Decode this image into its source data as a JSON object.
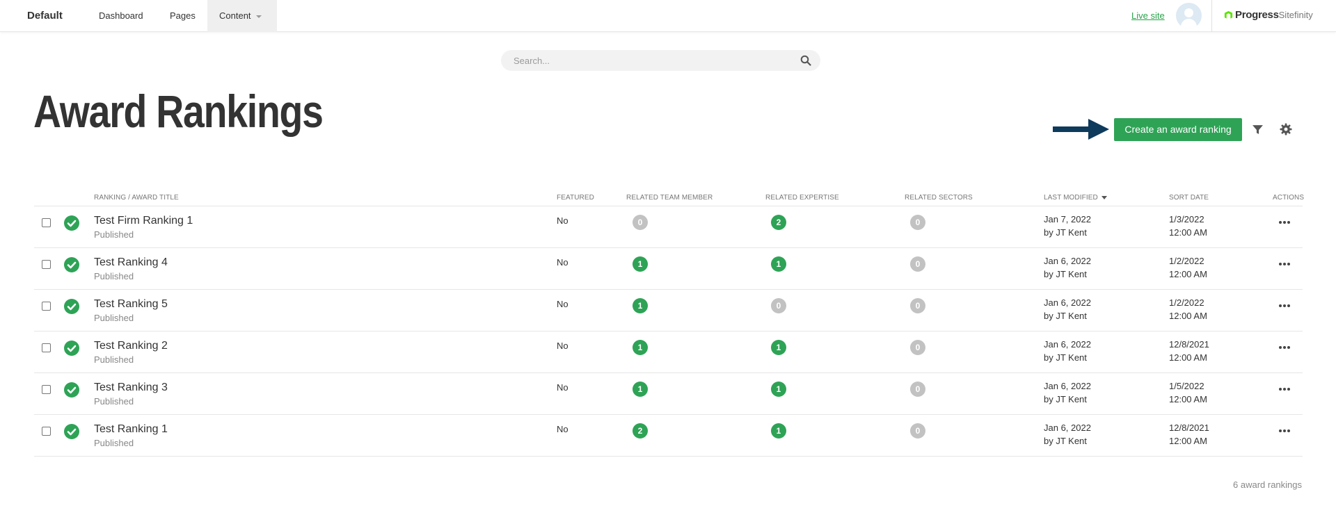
{
  "topbar": {
    "site_name": "Default",
    "nav": [
      {
        "label": "Dashboard"
      },
      {
        "label": "Pages"
      },
      {
        "label": "Content"
      }
    ],
    "live_site": "Live site",
    "brand_bold": "Progress",
    "brand_light": "Sitefinity"
  },
  "search": {
    "placeholder": "Search..."
  },
  "page": {
    "title": "Award Rankings",
    "create_button": "Create an award ranking"
  },
  "table": {
    "columns": {
      "title": "RANKING / AWARD TITLE",
      "featured": "FEATURED",
      "team": "RELATED TEAM MEMBER",
      "expertise": "RELATED EXPERTISE",
      "sectors": "RELATED SECTORS",
      "modified": "LAST MODIFIED",
      "sort_date": "SORT DATE",
      "actions": "ACTIONS"
    },
    "rows": [
      {
        "title": "Test Firm Ranking 1",
        "status": "Published",
        "featured": "No",
        "team": "0",
        "expertise": "2",
        "sectors": "0",
        "modified_date": "Jan 7, 2022",
        "modified_by": "by JT Kent",
        "sort_date": "1/3/2022",
        "sort_time": "12:00 AM"
      },
      {
        "title": "Test Ranking 4",
        "status": "Published",
        "featured": "No",
        "team": "1",
        "expertise": "1",
        "sectors": "0",
        "modified_date": "Jan 6, 2022",
        "modified_by": "by JT Kent",
        "sort_date": "1/2/2022",
        "sort_time": "12:00 AM"
      },
      {
        "title": "Test Ranking 5",
        "status": "Published",
        "featured": "No",
        "team": "1",
        "expertise": "0",
        "sectors": "0",
        "modified_date": "Jan 6, 2022",
        "modified_by": "by JT Kent",
        "sort_date": "1/2/2022",
        "sort_time": "12:00 AM"
      },
      {
        "title": "Test Ranking 2",
        "status": "Published",
        "featured": "No",
        "team": "1",
        "expertise": "1",
        "sectors": "0",
        "modified_date": "Jan 6, 2022",
        "modified_by": "by JT Kent",
        "sort_date": "12/8/2021",
        "sort_time": "12:00 AM"
      },
      {
        "title": "Test Ranking 3",
        "status": "Published",
        "featured": "No",
        "team": "1",
        "expertise": "1",
        "sectors": "0",
        "modified_date": "Jan 6, 2022",
        "modified_by": "by JT Kent",
        "sort_date": "1/5/2022",
        "sort_time": "12:00 AM"
      },
      {
        "title": "Test Ranking 1",
        "status": "Published",
        "featured": "No",
        "team": "2",
        "expertise": "1",
        "sectors": "0",
        "modified_date": "Jan 6, 2022",
        "modified_by": "by JT Kent",
        "sort_date": "12/8/2021",
        "sort_time": "12:00 AM"
      }
    ]
  },
  "footer": {
    "count": "6 award rankings"
  },
  "colors": {
    "accent": "#2ea356",
    "badge_zero": "#c2c2c2",
    "arrow": "#0e3a5c"
  }
}
